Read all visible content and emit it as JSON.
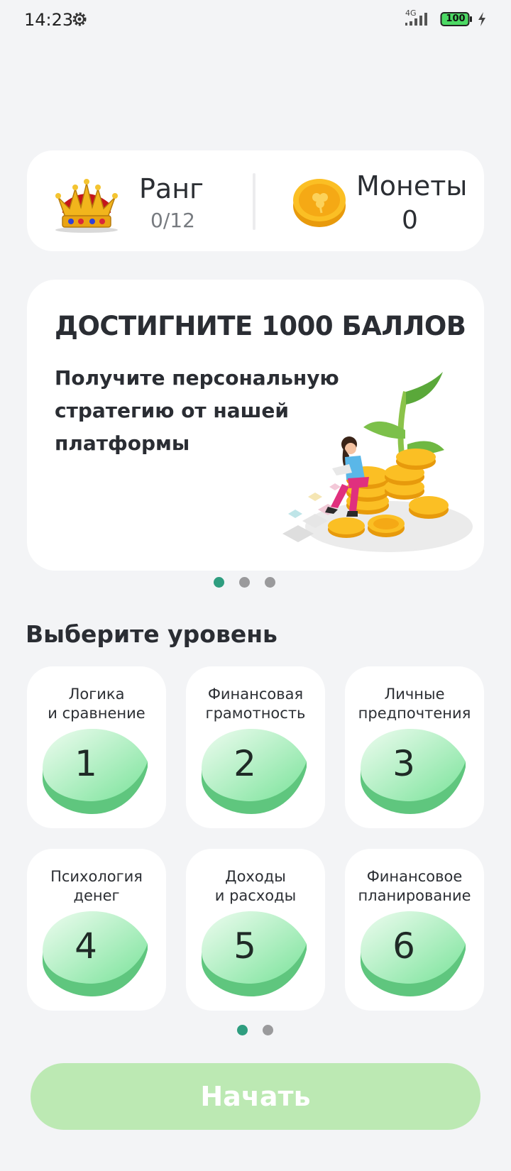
{
  "status_bar": {
    "time": "14:23",
    "network": "4G",
    "battery": "100",
    "icons": [
      "gear-icon",
      "signal-icon",
      "battery-icon",
      "bolt-icon"
    ]
  },
  "stats": {
    "rank_label": "Ранг",
    "rank_value": "0/12",
    "coins_label": "Монеты",
    "coins_value": "0",
    "icons": [
      "crown-icon",
      "coin-icon"
    ]
  },
  "promo": {
    "title": "ДОСТИГНИТЕ 1000 БАЛЛОВ",
    "subtitle": "Получите персональную стратегию от нашей платформы",
    "illustration": "woman-on-coins-illustration",
    "slide_count": 3,
    "active_slide": 1
  },
  "levels": {
    "title": "Выберите уровень",
    "page_count": 2,
    "active_page": 1,
    "items": [
      {
        "line1": "Логика",
        "line2": "и сравнение",
        "number": "1"
      },
      {
        "line1": "Финансовая",
        "line2": "грамотность",
        "number": "2"
      },
      {
        "line1": "Личные",
        "line2": "предпочтения",
        "number": "3"
      },
      {
        "line1": "Психология",
        "line2": "денег",
        "number": "4"
      },
      {
        "line1": "Доходы",
        "line2": "и расходы",
        "number": "5"
      },
      {
        "line1": "Финансовое",
        "line2": "планирование",
        "number": "6"
      }
    ]
  },
  "start_button": {
    "label": "Начать",
    "color": "#bce9b3"
  },
  "colors": {
    "background": "#f3f4f6",
    "accent": "#2e9d7f",
    "leaf_light": "#e6fbea",
    "leaf_dark": "#5fc97f"
  }
}
